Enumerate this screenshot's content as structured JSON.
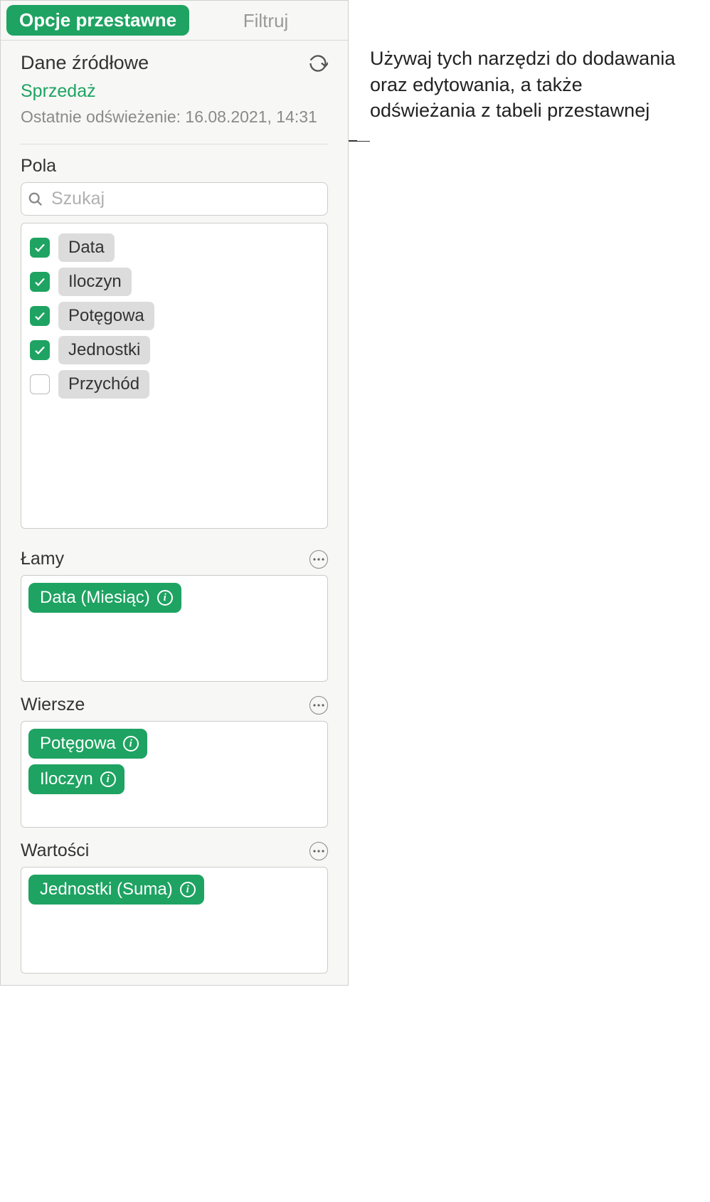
{
  "tabs": {
    "pivot": "Opcje przestawne",
    "filter": "Filtruj"
  },
  "source": {
    "title": "Dane źródłowe",
    "name": "Sprzedaż",
    "timestamp": "Ostatnie odświeżenie: 16.08.2021, 14:31"
  },
  "fields": {
    "label": "Pola",
    "search_placeholder": "Szukaj",
    "items": [
      {
        "label": "Data",
        "checked": true
      },
      {
        "label": "Iloczyn",
        "checked": true
      },
      {
        "label": "Potęgowa",
        "checked": true
      },
      {
        "label": "Jednostki",
        "checked": true
      },
      {
        "label": "Przychód",
        "checked": false
      }
    ]
  },
  "zones": {
    "columns": {
      "title": "Łamy",
      "items": [
        "Data (Miesiąc)"
      ]
    },
    "rows": {
      "title": "Wiersze",
      "items": [
        "Potęgowa",
        "Iloczyn"
      ]
    },
    "values": {
      "title": "Wartości",
      "items": [
        "Jednostki (Suma)"
      ]
    }
  },
  "callout": "Używaj tych narzędzi do dodawania oraz edytowania, a także odświeżania z tabeli przestawnej"
}
